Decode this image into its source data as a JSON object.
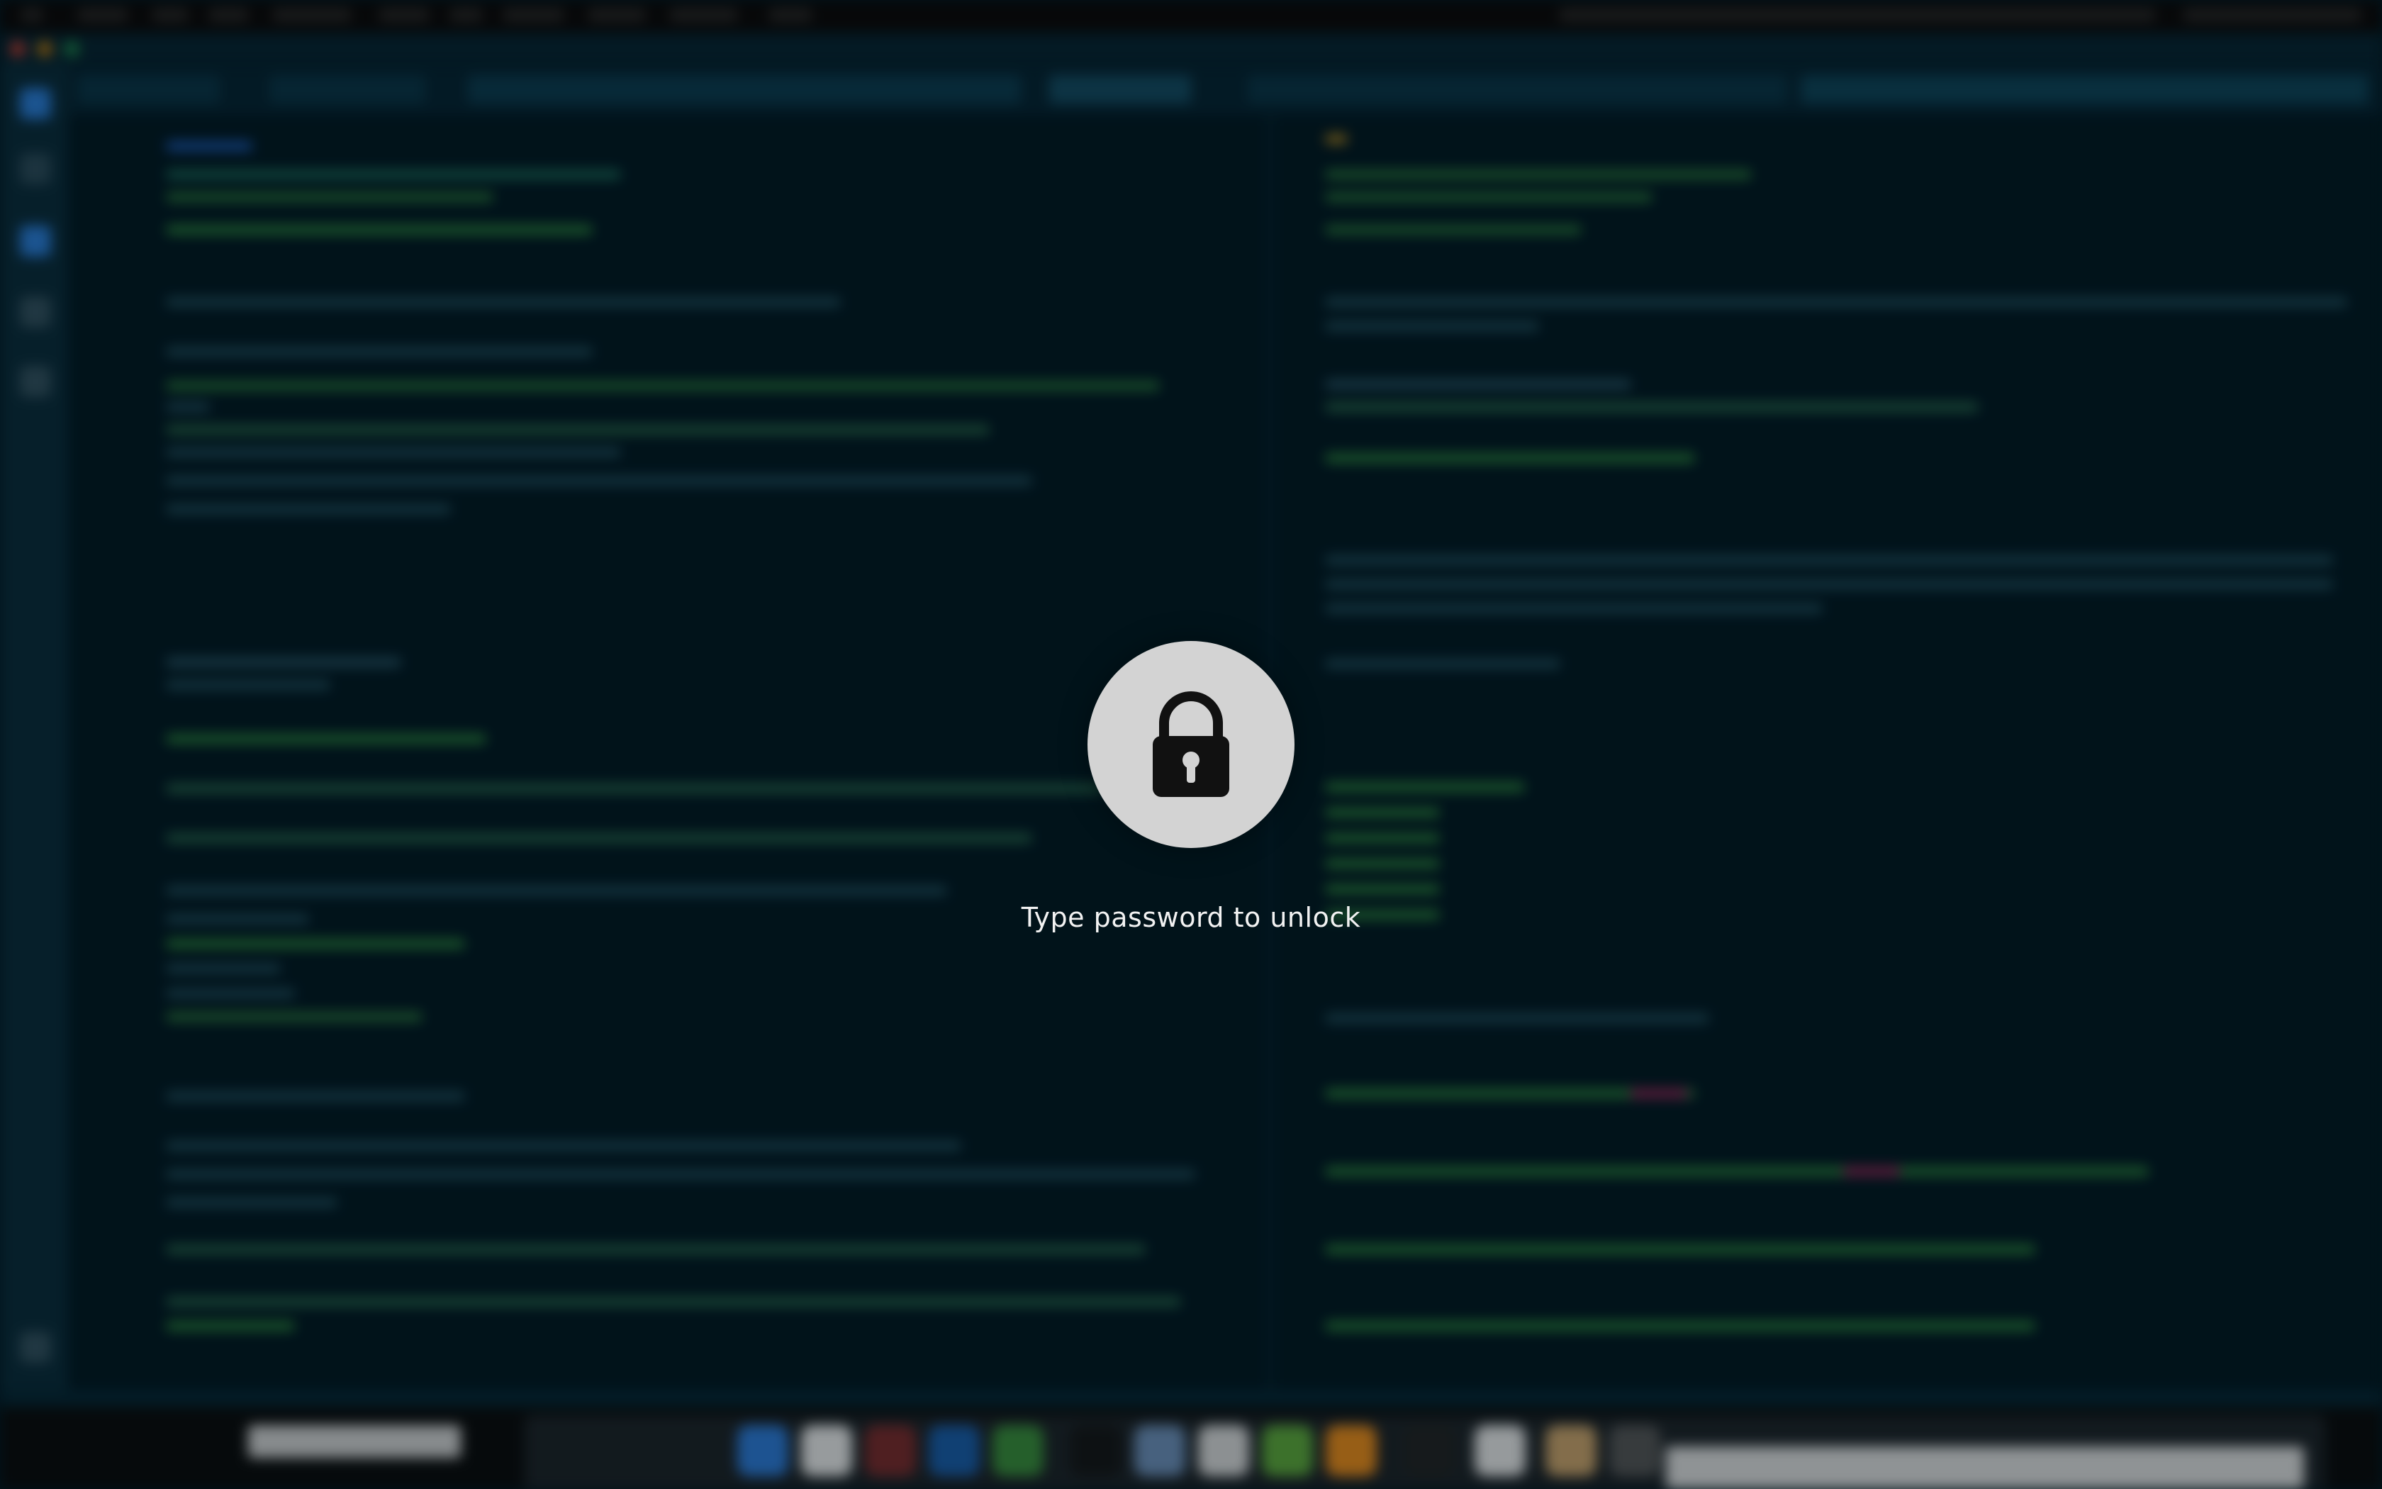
{
  "lock_screen": {
    "prompt": "Type password to unlock",
    "icon": "padlock-icon"
  },
  "colors": {
    "background": "#031821",
    "lock_circle": "#d3d3d3",
    "lock_glyph": "#111111",
    "prompt_text": "#f2f2f2"
  }
}
